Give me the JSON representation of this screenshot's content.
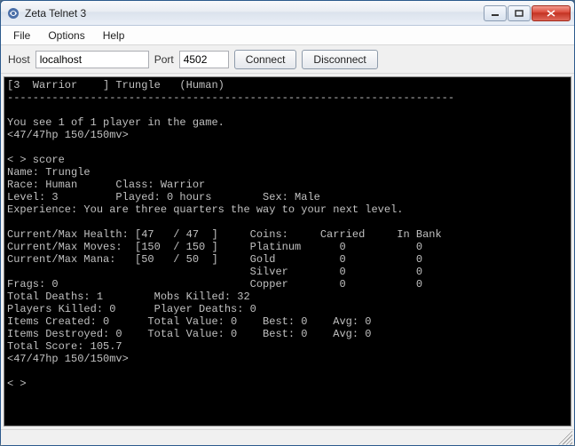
{
  "window": {
    "title": "Zeta Telnet 3"
  },
  "menu": {
    "file": "File",
    "options": "Options",
    "help": "Help"
  },
  "toolbar": {
    "host_label": "Host",
    "host_value": "localhost",
    "port_label": "Port",
    "port_value": "4502",
    "connect_label": "Connect",
    "disconnect_label": "Disconnect"
  },
  "terminal": {
    "content": "[3  Warrior    ] Trungle   (Human)\n----------------------------------------------------------------------\n\nYou see 1 of 1 player in the game.\n<47/47hp 150/150mv>\n\n< > score\nName: Trungle\nRace: Human      Class: Warrior\nLevel: 3         Played: 0 hours        Sex: Male\nExperience: You are three quarters the way to your next level.\n\nCurrent/Max Health: [47   / 47  ]     Coins:     Carried     In Bank\nCurrent/Max Moves:  [150  / 150 ]     Platinum      0           0\nCurrent/Max Mana:   [50   / 50  ]     Gold          0           0\n                                      Silver        0           0\nFrags: 0                              Copper        0           0\nTotal Deaths: 1        Mobs Killed: 32\nPlayers Killed: 0      Player Deaths: 0\nItems Created: 0      Total Value: 0    Best: 0    Avg: 0\nItems Destroyed: 0    Total Value: 0    Best: 0    Avg: 0\nTotal Score: 105.7\n<47/47hp 150/150mv>\n\n< >"
  },
  "score": {
    "name": "Trungle",
    "race": "Human",
    "class": "Warrior",
    "level": 3,
    "played": "0 hours",
    "sex": "Male",
    "experience": "You are three quarters the way to your next level.",
    "health": {
      "current": 47,
      "max": 47
    },
    "moves": {
      "current": 150,
      "max": 150
    },
    "mana": {
      "current": 50,
      "max": 50
    },
    "coins": {
      "platinum": {
        "carried": 0,
        "bank": 0
      },
      "gold": {
        "carried": 0,
        "bank": 0
      },
      "silver": {
        "carried": 0,
        "bank": 0
      },
      "copper": {
        "carried": 0,
        "bank": 0
      }
    },
    "frags": 0,
    "total_deaths": 1,
    "mobs_killed": 32,
    "players_killed": 0,
    "player_deaths": 0,
    "items_created": {
      "count": 0,
      "total_value": 0,
      "best": 0,
      "avg": 0
    },
    "items_destroyed": {
      "count": 0,
      "total_value": 0,
      "best": 0,
      "avg": 0
    },
    "total_score": 105.7
  }
}
